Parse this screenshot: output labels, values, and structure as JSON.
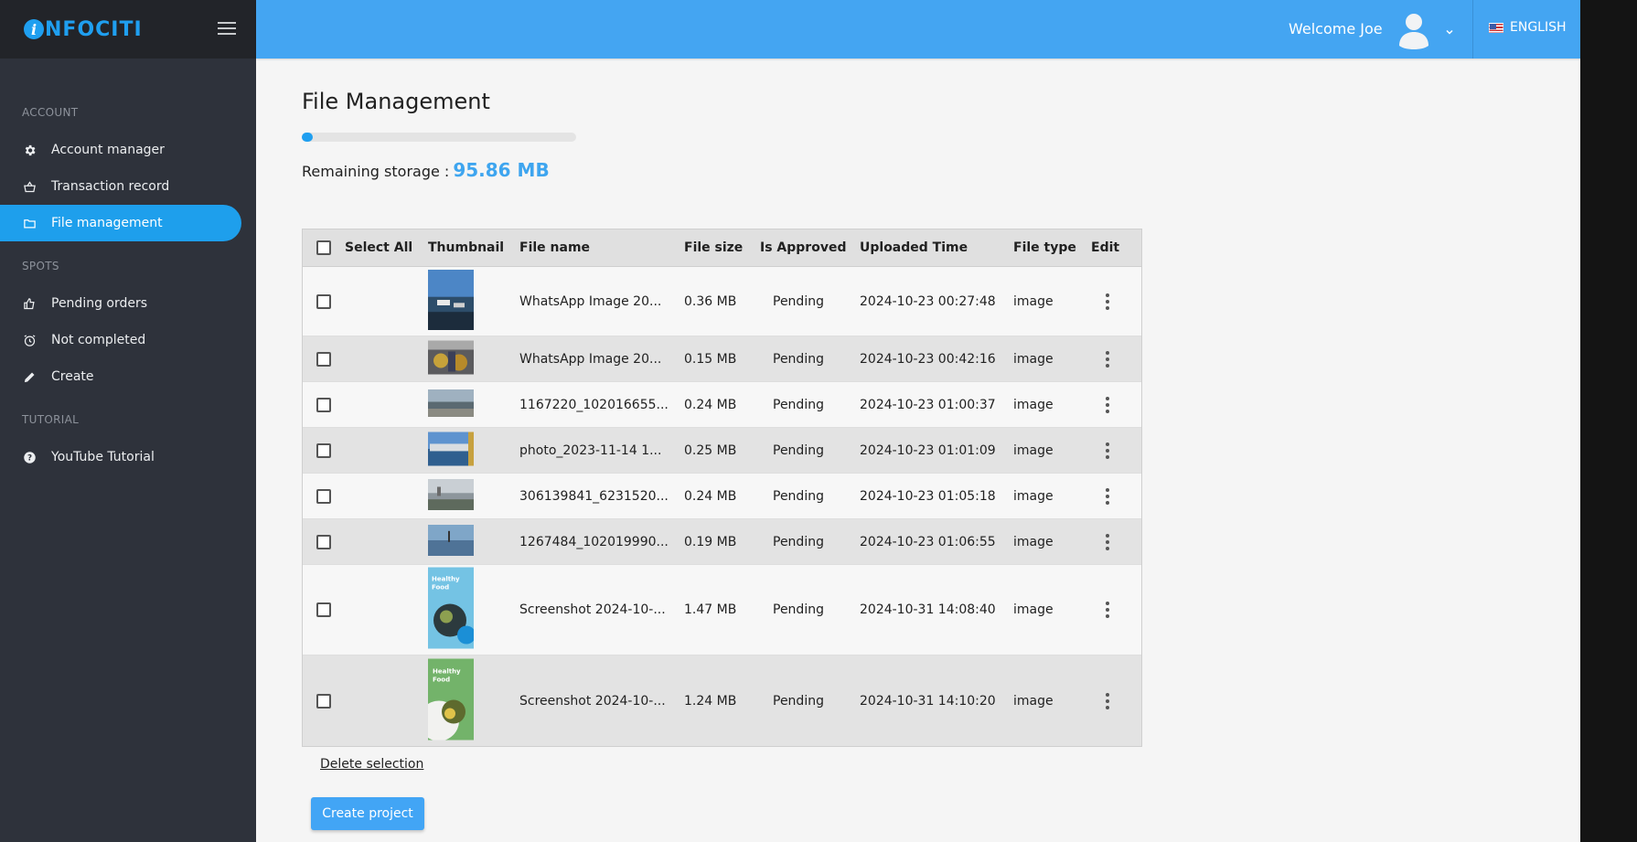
{
  "brand": {
    "logo_letter": "i",
    "logo_text": "NFOCITI"
  },
  "sidebar": {
    "sections": [
      {
        "label": "ACCOUNT",
        "items": [
          {
            "label": "Account manager",
            "icon": "gear-icon"
          },
          {
            "label": "Transaction record",
            "icon": "basket-icon"
          },
          {
            "label": "File management",
            "icon": "folder-icon",
            "active": true
          }
        ]
      },
      {
        "label": "SPOTS",
        "items": [
          {
            "label": "Pending orders",
            "icon": "thumbs-up-icon"
          },
          {
            "label": "Not completed",
            "icon": "alarm-clock-icon"
          },
          {
            "label": "Create",
            "icon": "pencil-icon"
          }
        ]
      },
      {
        "label": "TUTORIAL",
        "items": [
          {
            "label": "YouTube Tutorial",
            "icon": "help-circle-icon"
          }
        ]
      }
    ]
  },
  "header": {
    "welcome": "Welcome Joe",
    "language": "ENGLISH"
  },
  "main": {
    "title": "File Management",
    "storage_used_fraction": 0.04,
    "storage_label": "Remaining storage :",
    "storage_value": "95.86 MB",
    "delete_label": "Delete selection",
    "create_label": "Create project"
  },
  "table": {
    "columns": [
      "Select All",
      "Thumbnail",
      "File name",
      "File size",
      "Is Approved",
      "Uploaded Time",
      "File type",
      "Edit"
    ],
    "rows": [
      {
        "name": "WhatsApp Image 20...",
        "size": "0.36 MB",
        "approved": "Pending",
        "time": "2024-10-23 00:27:48",
        "type": "image",
        "thumb": "harbor-boats"
      },
      {
        "name": "WhatsApp Image 20...",
        "size": "0.15 MB",
        "approved": "Pending",
        "time": "2024-10-23 00:42:16",
        "type": "image",
        "thumb": "food-tray"
      },
      {
        "name": "1167220_102016655...",
        "size": "0.24 MB",
        "approved": "Pending",
        "time": "2024-10-23 01:00:37",
        "type": "image",
        "thumb": "shoreline"
      },
      {
        "name": "photo_2023-11-14 1...",
        "size": "0.25 MB",
        "approved": "Pending",
        "time": "2024-10-23 01:01:09",
        "type": "image",
        "thumb": "city-coast"
      },
      {
        "name": "306139841_6231520...",
        "size": "0.24 MB",
        "approved": "Pending",
        "time": "2024-10-23 01:05:18",
        "type": "image",
        "thumb": "waterfront"
      },
      {
        "name": "1267484_102019990...",
        "size": "0.19 MB",
        "approved": "Pending",
        "time": "2024-10-23 01:06:55",
        "type": "image",
        "thumb": "sea-sky"
      },
      {
        "name": "Screenshot 2024-10-...",
        "size": "1.47 MB",
        "approved": "Pending",
        "time": "2024-10-31 14:08:40",
        "type": "image",
        "thumb": "healthy-food-blue",
        "thumb_text": "Healthy Food"
      },
      {
        "name": "Screenshot 2024-10-...",
        "size": "1.24 MB",
        "approved": "Pending",
        "time": "2024-10-31 14:10:20",
        "type": "image",
        "thumb": "healthy-food-green",
        "thumb_text": "Healthy Food"
      }
    ]
  }
}
